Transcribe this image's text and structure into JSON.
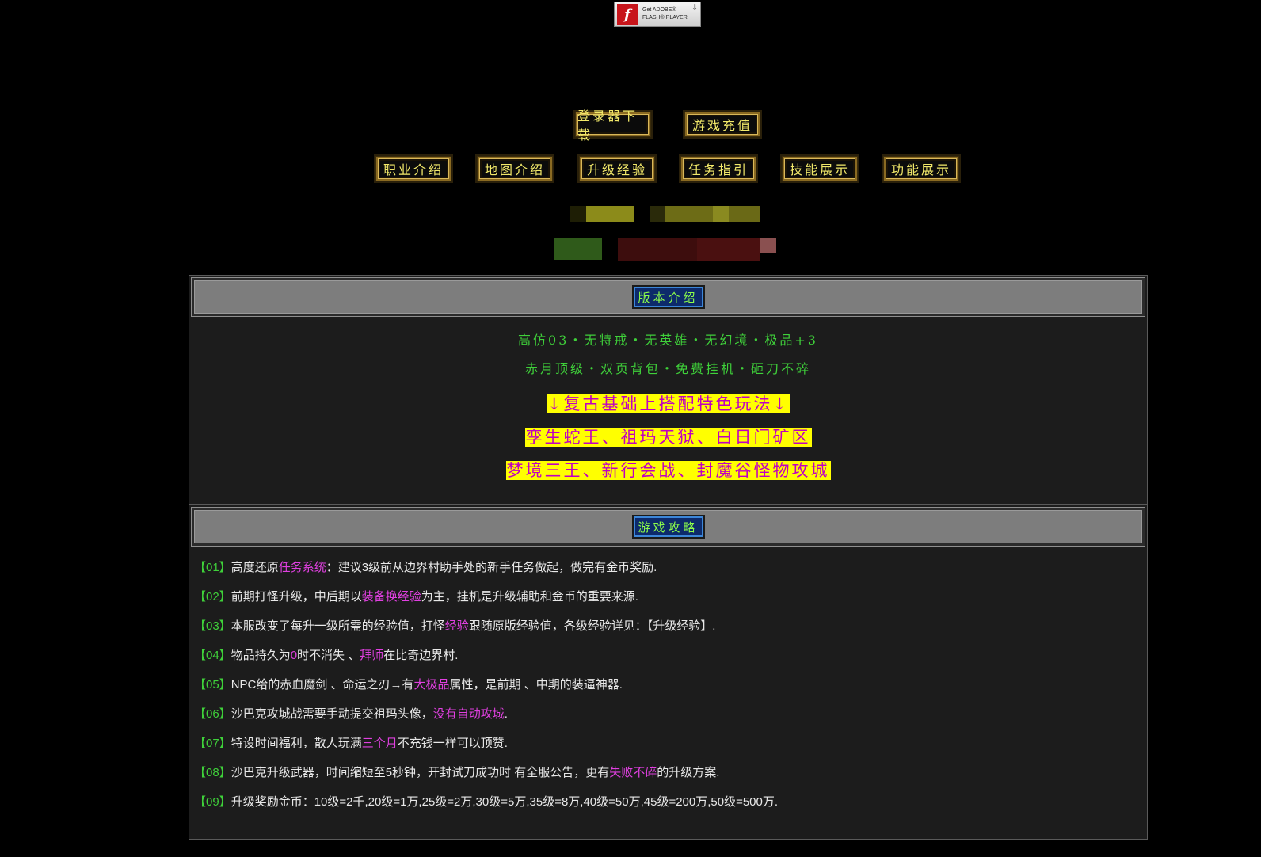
{
  "flash_badge": {
    "line1": "Get ADOBE®",
    "line2": "FLASH® PLAYER",
    "logo": "f"
  },
  "nav_top": [
    {
      "label": "登录器下载"
    },
    {
      "label": "游戏充值"
    }
  ],
  "nav_main": [
    {
      "label": "职业介绍"
    },
    {
      "label": "地图介绍"
    },
    {
      "label": "升级经验"
    },
    {
      "label": "任务指引"
    },
    {
      "label": "技能展示"
    },
    {
      "label": "功能展示"
    }
  ],
  "version_panel": {
    "title": "版本介绍",
    "green_lines": [
      "高仿03・无特戒・无英雄・无幻境・极品+3",
      "赤月顶级・双页背包・免费挂机・砸刀不碎"
    ],
    "yellow_lines": [
      "↓复古基础上搭配特色玩法↓",
      "孪生蛇王、祖玛天狱、白日门矿区",
      "梦境三王、新行会战、封魔谷怪物攻城"
    ]
  },
  "guide_panel": {
    "title": "游戏攻略",
    "items": [
      {
        "num": "【01】",
        "parts": [
          {
            "t": "高度还原"
          },
          {
            "t": "任务系统",
            "hl": true
          },
          {
            "t": "：建议3级前从边界村助手处的新手任务做起，做完有金币奖励."
          }
        ]
      },
      {
        "num": "【02】",
        "parts": [
          {
            "t": "前期打怪升级，中后期以"
          },
          {
            "t": "装备换经验",
            "hl": true
          },
          {
            "t": "为主，挂机是升级辅助和金币的重要来源."
          }
        ]
      },
      {
        "num": "【03】",
        "parts": [
          {
            "t": "本服改变了每升一级所需的经验值，打怪"
          },
          {
            "t": "经验",
            "hl": true
          },
          {
            "t": "跟随原版经验值，各级经验详见：【升级经验】."
          }
        ]
      },
      {
        "num": "【04】",
        "parts": [
          {
            "t": "物品持久为"
          },
          {
            "t": "0",
            "hl": true
          },
          {
            "t": "时不消失 、"
          },
          {
            "t": "拜师",
            "hl": true
          },
          {
            "t": "在比奇边界村."
          }
        ]
      },
      {
        "num": "【05】",
        "parts": [
          {
            "t": "NPC给的赤血魔剑 、命运之刃→有"
          },
          {
            "t": "大极品",
            "hl": true
          },
          {
            "t": "属性，是前期 、中期的装逼神器."
          }
        ]
      },
      {
        "num": "【06】",
        "parts": [
          {
            "t": "沙巴克攻城战需要手动提交祖玛头像，"
          },
          {
            "t": "没有自动攻城",
            "hl": true
          },
          {
            "t": "."
          }
        ]
      },
      {
        "num": "【07】",
        "parts": [
          {
            "t": "特设时间福利，散人玩满"
          },
          {
            "t": "三个月",
            "hl": true
          },
          {
            "t": "不充钱一样可以顶赞."
          }
        ]
      },
      {
        "num": "【08】",
        "parts": [
          {
            "t": "沙巴克升级武器，时间缩短至5秒钟，开封试刀成功时 有全服公告，更有"
          },
          {
            "t": "失败不碎",
            "hl": true
          },
          {
            "t": "的升级方案."
          }
        ]
      },
      {
        "num": "【09】",
        "parts": [
          {
            "t": "升级奖励金币：10级=2千,20级=1万,25级=2万,30级=5万,35级=8万,40级=50万,45级=200万,50级=500万."
          }
        ]
      }
    ]
  }
}
